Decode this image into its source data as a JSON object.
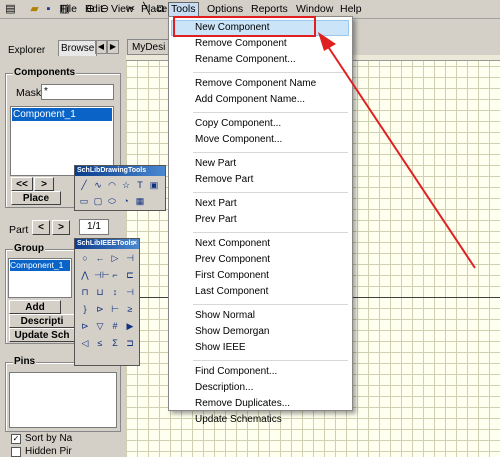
{
  "menubar": {
    "items": [
      "File",
      "Edit",
      "View",
      "Place",
      "Tools",
      "Options",
      "Reports",
      "Window",
      "Help"
    ],
    "active": "Tools"
  },
  "explorer": {
    "tabs": [
      "Explorer",
      "Browse"
    ],
    "document_tab": "MyDesi",
    "components_title": "Components",
    "mask_label": "Mask",
    "mask_value": "*",
    "component_list": [
      "Component_1"
    ],
    "nav_buttons": [
      "<<",
      ">"
    ],
    "place_label": "Place",
    "part_label": "Part",
    "part_value": "1/1",
    "group_title": "Group",
    "group_list": [
      "Component_1"
    ],
    "add_label": "Add",
    "description_label": "Descripti",
    "update_label": "Update Sch",
    "pins_title": "Pins",
    "sort_label": "Sort by Na",
    "hidden_label": "Hidden Pir"
  },
  "drawing_tools": {
    "title": "SchLibDrawingTools",
    "icons": [
      "line-icon",
      "bezier-icon",
      "arc-icon",
      "polygon-icon",
      "text-icon",
      "image-icon",
      "rectangle-icon",
      "rounded-rect-icon",
      "ellipse-icon",
      "pie-icon",
      "array-icon"
    ],
    "glyphs": [
      "╱",
      "∿",
      "◠",
      "☆",
      "T",
      "▣",
      "▭",
      "▢",
      "⬭",
      "◔",
      "▦"
    ]
  },
  "ieee_tools": {
    "title": "SchLibIEEETools",
    "glyphs": [
      "○",
      "←",
      "▷",
      "⊣",
      "⋀",
      "⊣⊢",
      "⌐",
      "⊏",
      "⊓",
      "⊔",
      "↕",
      "⊣",
      "}",
      "⊳",
      "⊢",
      "≥",
      "⊳",
      "▽",
      "#",
      "▶",
      "◁",
      "≤",
      "Σ",
      "⊐"
    ]
  },
  "tools_menu": {
    "sections": [
      [
        "New Component",
        "Remove Component",
        "Rename Component..."
      ],
      [
        "Remove Component Name",
        "Add Component Name..."
      ],
      [
        "Copy Component...",
        "Move Component..."
      ],
      [
        "New Part",
        "Remove Part"
      ],
      [
        "Next Part",
        "Prev Part"
      ],
      [
        "Next Component",
        "Prev Component",
        "First Component",
        "Last Component"
      ],
      [
        "Show Normal",
        "Show Demorgan",
        "Show IEEE"
      ],
      [
        "Find Component...",
        "Description...",
        "Remove Duplicates...",
        "Update Schematics"
      ]
    ],
    "highlighted": "New Component"
  },
  "colors": {
    "annotation_red": "#e02020",
    "selection_blue": "#0a64c8",
    "canvas_bg": "#fffff0"
  }
}
